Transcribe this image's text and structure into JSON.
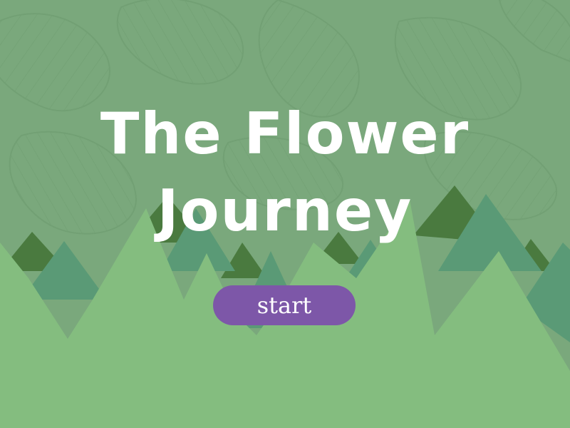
{
  "title": {
    "line1": "The Flower",
    "line2": "Journey"
  },
  "start_label": "start",
  "colors": {
    "background": "#7aa87c",
    "pattern_line": "#6c9a6e",
    "tree_dark": "#4a7a3f",
    "tree_teal": "#5a9a76",
    "tree_light": "#84bd7f",
    "title_text": "#ffffff",
    "button": "#7d57a8",
    "button_text": "#ffffff"
  }
}
